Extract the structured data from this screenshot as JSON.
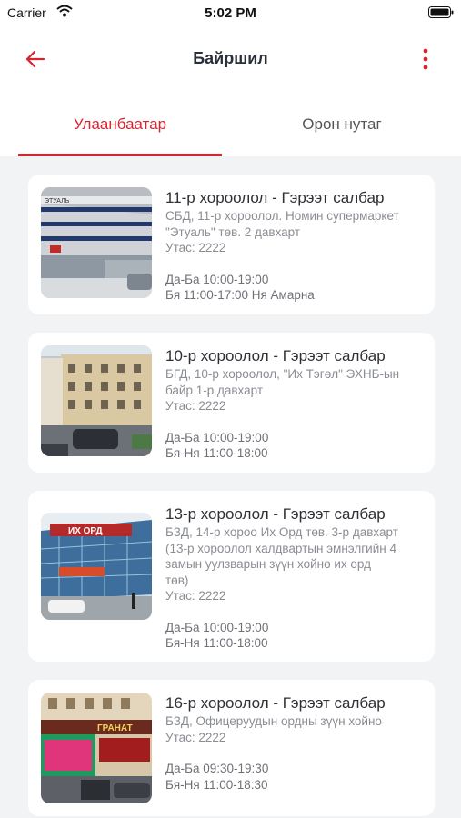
{
  "status_bar": {
    "carrier": "Carrier",
    "time": "5:02 PM"
  },
  "nav": {
    "title": "Байршил"
  },
  "tabs": [
    {
      "label": "Улаанбаатар",
      "active": true
    },
    {
      "label": "Орон нутаг",
      "active": false
    }
  ],
  "accent_color": "#d8242f",
  "branches": [
    {
      "title": "11-р хороолол - Гэрээт салбар",
      "address_lines": [
        "СБД, 11-р хороолол. Номин супермаркет",
        "\"Этуаль\" төв. 2 давхарт"
      ],
      "phone": "Утас: 2222",
      "hours_lines": [
        "Да-Ба 10:00-19:00",
        "Бя 11:00-17:00 Ня Амарна"
      ],
      "sign_text": "ЭТУАЛЬ"
    },
    {
      "title": "10-р хороолол - Гэрээт салбар",
      "address_lines": [
        "БГД, 10-р хороолол, \"Их Тэгөл\" ЭХНБ-ын",
        "байр 1-р давхарт"
      ],
      "phone": "Утас: 2222",
      "hours_lines": [
        "Да-Ба 10:00-19:00",
        "Бя-Ня 11:00-18:00"
      ],
      "sign_text": ""
    },
    {
      "title": "13-р хороолол - Гэрээт салбар",
      "address_lines": [
        "БЗД, 14-р хороо Их Орд төв. 3-р давхарт",
        "(13-р хороолол халдвартын эмнэлгийн 4",
        "замын уулзварын зүүн хойно их орд",
        "төв)"
      ],
      "phone": "Утас: 2222",
      "hours_lines": [
        "Да-Ба 10:00-19:00",
        "Бя-Ня 11:00-18:00"
      ],
      "sign_text": "ИХ ОРД"
    },
    {
      "title": "16-р хороолол - Гэрээт салбар",
      "address_lines": [
        "БЗД, Офицеруудын ордны зүүн хойно"
      ],
      "phone": "Утас: 2222",
      "hours_lines": [
        "Да-Ба 09:30-19:30",
        "Бя-Ня 11:00-18:30"
      ],
      "sign_text": "ГРАНАТ"
    }
  ]
}
